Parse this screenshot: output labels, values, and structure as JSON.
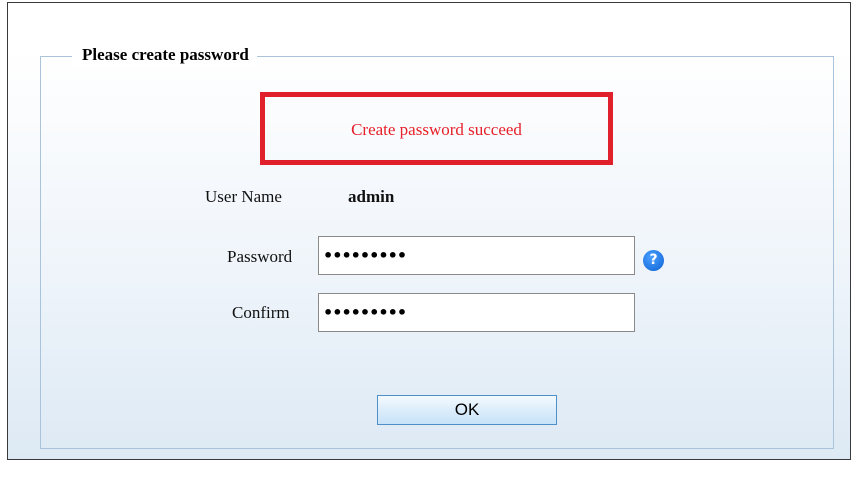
{
  "dialog": {
    "legend": "Please create password",
    "status_message": "Create password succeed",
    "status_color": "#e8202a",
    "highlight_color": "#e0202a"
  },
  "form": {
    "username_label": "User Name",
    "username_value": "admin",
    "password_label": "Password",
    "password_value": "123456789",
    "confirm_label": "Confirm",
    "confirm_value": "123456789",
    "help_icon": "question-circle-icon",
    "help_glyph": "?"
  },
  "buttons": {
    "ok_label": "OK"
  }
}
